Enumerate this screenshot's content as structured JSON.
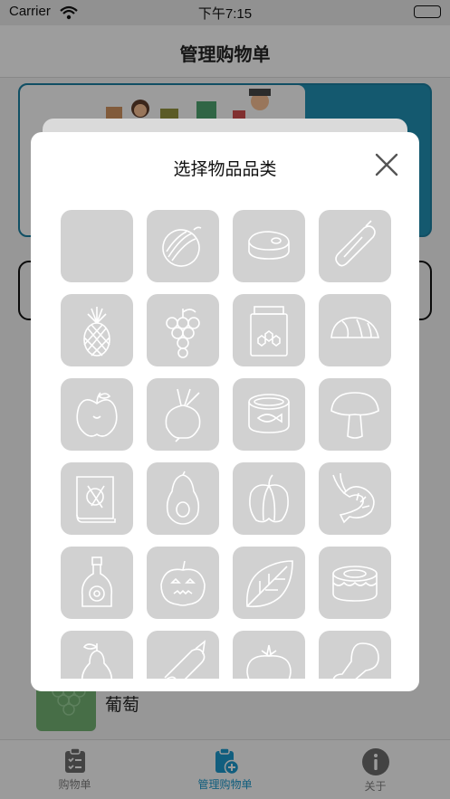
{
  "status": {
    "carrier": "Carrier",
    "time": "下午7:15"
  },
  "nav": {
    "title": "管理购物单"
  },
  "background_item": {
    "label": "葡萄"
  },
  "tabs": [
    {
      "label": "购物单",
      "icon": "clipboard-list-icon",
      "active": false
    },
    {
      "label": "管理购物单",
      "icon": "clipboard-add-icon",
      "active": true
    },
    {
      "label": "关于",
      "icon": "info-icon",
      "active": false
    }
  ],
  "modal": {
    "title": "选择物品品类",
    "categories": [
      {
        "icon": "blank-icon"
      },
      {
        "icon": "watermelon-icon"
      },
      {
        "icon": "meat-icon"
      },
      {
        "icon": "zucchini-icon"
      },
      {
        "icon": "pineapple-icon"
      },
      {
        "icon": "grapes-icon"
      },
      {
        "icon": "honey-jar-icon"
      },
      {
        "icon": "taco-icon"
      },
      {
        "icon": "apple-icon"
      },
      {
        "icon": "turnip-icon"
      },
      {
        "icon": "canned-fish-icon"
      },
      {
        "icon": "mushroom-icon"
      },
      {
        "icon": "cookbook-icon"
      },
      {
        "icon": "avocado-icon"
      },
      {
        "icon": "bell-pepper-icon"
      },
      {
        "icon": "shrimp-icon"
      },
      {
        "icon": "oil-bottle-icon"
      },
      {
        "icon": "pumpkin-icon"
      },
      {
        "icon": "leaf-icon"
      },
      {
        "icon": "cake-icon"
      },
      {
        "icon": "pear-icon"
      },
      {
        "icon": "sausage-icon"
      },
      {
        "icon": "tomato-icon"
      },
      {
        "icon": "drumstick-icon"
      }
    ]
  },
  "colors": {
    "accent": "#1a8fbf",
    "tile": "#d1d1d1",
    "icon_stroke": "#ffffff"
  }
}
